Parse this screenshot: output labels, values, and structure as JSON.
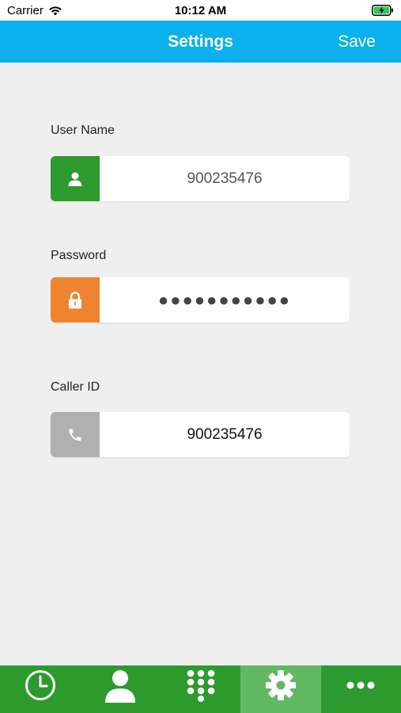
{
  "status_bar": {
    "carrier": "Carrier",
    "time": "10:12 AM",
    "icons": [
      "wifi-icon",
      "battery-charging-icon"
    ]
  },
  "nav": {
    "title": "Settings",
    "save_label": "Save",
    "color": "#0cb0ec"
  },
  "form": {
    "user_name": {
      "label": "User Name",
      "value": "900235476",
      "icon": "person-icon",
      "icon_color": "#2d9a2d"
    },
    "password": {
      "label": "Password",
      "value": "●●●●●●●●●●●",
      "icon": "lock-icon",
      "icon_color": "#ef8330"
    },
    "caller_id": {
      "label": "Caller ID",
      "value": "900235476",
      "icon": "phone-icon",
      "icon_color": "#b0b0b0"
    }
  },
  "tab_bar": {
    "color": "#2d9a2d",
    "active_color": "#63b863",
    "tabs": [
      {
        "icon": "clock-icon",
        "active": false
      },
      {
        "icon": "person-icon",
        "active": false
      },
      {
        "icon": "keypad-icon",
        "active": false
      },
      {
        "icon": "gear-icon",
        "active": true
      },
      {
        "icon": "more-icon",
        "active": false
      }
    ]
  }
}
